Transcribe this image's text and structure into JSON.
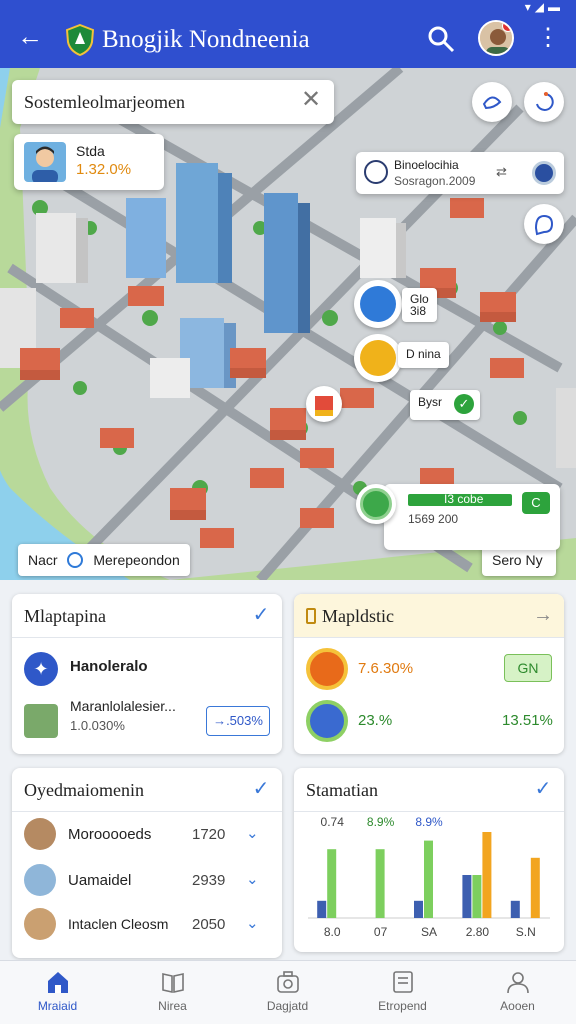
{
  "app_bar": {
    "title": "Bnogjik Nondneenia",
    "status_icons": "▾◢▬"
  },
  "map": {
    "search": {
      "text": "Sostemleolmarjeomen"
    },
    "profile_card": {
      "name": "Stda",
      "value": "1.32.0%"
    },
    "poi_card": {
      "line1": "Binoelocihia",
      "line2": "Sosragon.2009",
      "arrow": "⇄"
    },
    "pins": [
      {
        "label": "Glo\n3i8",
        "color": "#2f7ad8"
      },
      {
        "label": "D nina",
        "color": "#f0b21a"
      }
    ],
    "chip_check": {
      "label": "Bysr"
    },
    "task_card": {
      "label": "I3  cobe",
      "sub": "1569 200"
    },
    "bottom_chips": {
      "left": "Nacr",
      "left_value": "Merepeondon",
      "right": "Sero Ny"
    }
  },
  "cards": {
    "mapping": {
      "title": "Mlaptapina",
      "item1": "Hanoleralo",
      "item2_name": "Maranlolalesier...",
      "item2_value": "1.0.030%",
      "button": "→.503%"
    },
    "analytics": {
      "title": "Mapldstic",
      "stat1_value": "7.6.30%",
      "stat1_badge": "GN",
      "stat2_value": "23.%",
      "stat2_right": "13.51%"
    },
    "operations": {
      "title": "Oyedmaiomenin",
      "rows": [
        {
          "name": "Morooooeds",
          "value": "1720"
        },
        {
          "name": "Uamaidel",
          "value": "2939"
        },
        {
          "name": "Intaclen Cleosm",
          "value": "2050"
        }
      ]
    },
    "statistics": {
      "title": "Stamatian",
      "bar_labels_top": [
        "0.74",
        "8.9%",
        "8.9%"
      ],
      "x_labels": [
        "8.0",
        "07",
        "SA",
        "2.80",
        "S.N"
      ]
    }
  },
  "chart_data": {
    "type": "bar",
    "title": "Stamatian",
    "categories": [
      "8.0",
      "07",
      "SA",
      "2.80",
      "S.N"
    ],
    "series": [
      {
        "values": [
          2,
          0,
          2,
          5,
          2
        ]
      },
      {
        "values": [
          8,
          8,
          9,
          5,
          0
        ]
      },
      {
        "values": [
          0,
          0,
          0,
          10,
          7
        ]
      }
    ],
    "ylim": [
      0,
      10
    ],
    "colors": [
      "#3d5fb0",
      "#7dcf5e",
      "#f2a520"
    ]
  },
  "bottom_nav": [
    {
      "label": "Mraiaid",
      "icon": "home-icon",
      "active": true
    },
    {
      "label": "Nirea",
      "icon": "book-icon",
      "active": false
    },
    {
      "label": "Dagjatd",
      "icon": "camera-icon",
      "active": false
    },
    {
      "label": "Etropend",
      "icon": "tablet-icon",
      "active": false
    },
    {
      "label": "Aooen",
      "icon": "person-icon",
      "active": false
    }
  ]
}
